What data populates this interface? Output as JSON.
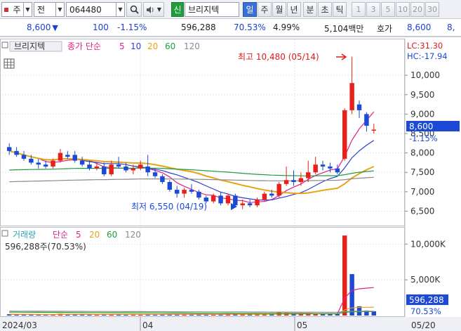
{
  "toolbar": {
    "market": "주",
    "jeon": "전",
    "code": "064480",
    "sin": "신",
    "name": "브리지텍",
    "periods": [
      "일",
      "주",
      "월",
      "년",
      "분",
      "초",
      "틱"
    ],
    "active_period": "일",
    "intervals": [
      "1",
      "3",
      "5",
      "10",
      "20",
      "30"
    ]
  },
  "quote": {
    "price": "8,600",
    "change": "100",
    "change_pct": "-1.15%",
    "volume": "596,288",
    "volume_ratio": "70.53%",
    "turnover": "4.99%",
    "amount": "5,104백만",
    "hoga_label": "호가",
    "hoga_price": "8,600",
    "trail": "8,"
  },
  "price_panel": {
    "legend_tab": "브리지텍",
    "ma_label": "종가 단순",
    "ma_periods": [
      "5",
      "10",
      "20",
      "60",
      "120"
    ],
    "ma_colors": [
      "#e0218a",
      "#2b3fd1",
      "#e8a317",
      "#1f9e3b",
      "#8a8a8a"
    ],
    "lc": "LC:31.30",
    "hc": "HC:-17.94",
    "current_price": "8,600",
    "current_pct": "-1.15%",
    "high_annotation": "최고 10,480 (05/14)",
    "low_annotation": "최저 6,550 (04/19)",
    "up_color": "#e8201a",
    "down_color": "#1c49d6"
  },
  "volume_panel": {
    "title": "거래량",
    "ma_label": "단순",
    "ma_periods": [
      "5",
      "20",
      "60",
      "120"
    ],
    "summary": "596,288주(70.53%)",
    "current_value": "596,288",
    "current_pct": "70.53%"
  },
  "x_axis": {
    "labels": [
      "2024/03",
      "04",
      "05"
    ],
    "right_label": "05/20"
  },
  "chart_data": {
    "type": "candlestick",
    "y_ticks": [
      10000,
      9500,
      9000,
      8500,
      8000,
      7500,
      7000,
      6500
    ],
    "ylim": [
      6200,
      10800
    ],
    "volume_ticks": [
      "10,000K",
      "5,000K"
    ],
    "volume_ylim": [
      0,
      12000
    ],
    "candles": [
      {
        "o": 8150,
        "h": 8250,
        "l": 7950,
        "c": 8050
      },
      {
        "o": 8050,
        "h": 8150,
        "l": 7900,
        "c": 7950
      },
      {
        "o": 7950,
        "h": 8050,
        "l": 7800,
        "c": 7850
      },
      {
        "o": 7850,
        "h": 7950,
        "l": 7700,
        "c": 7750
      },
      {
        "o": 7750,
        "h": 7850,
        "l": 7600,
        "c": 7700
      },
      {
        "o": 7700,
        "h": 7800,
        "l": 7600,
        "c": 7650
      },
      {
        "o": 7650,
        "h": 7850,
        "l": 7600,
        "c": 7800
      },
      {
        "o": 7800,
        "h": 8100,
        "l": 7750,
        "c": 8000
      },
      {
        "o": 7950,
        "h": 8050,
        "l": 7850,
        "c": 7900
      },
      {
        "o": 7950,
        "h": 8050,
        "l": 7750,
        "c": 7800
      },
      {
        "o": 7800,
        "h": 7900,
        "l": 7650,
        "c": 7700
      },
      {
        "o": 7700,
        "h": 7800,
        "l": 7550,
        "c": 7600
      },
      {
        "o": 7600,
        "h": 7750,
        "l": 7550,
        "c": 7650
      },
      {
        "o": 7650,
        "h": 7750,
        "l": 7400,
        "c": 7450
      },
      {
        "o": 7450,
        "h": 7800,
        "l": 7400,
        "c": 7700
      },
      {
        "o": 7700,
        "h": 7900,
        "l": 7600,
        "c": 7650
      },
      {
        "o": 7650,
        "h": 7750,
        "l": 7500,
        "c": 7550
      },
      {
        "o": 7550,
        "h": 7700,
        "l": 7450,
        "c": 7600
      },
      {
        "o": 7600,
        "h": 7800,
        "l": 7550,
        "c": 7700
      },
      {
        "o": 7650,
        "h": 7950,
        "l": 7400,
        "c": 7500
      },
      {
        "o": 7500,
        "h": 7600,
        "l": 7350,
        "c": 7400
      },
      {
        "o": 7400,
        "h": 7450,
        "l": 7200,
        "c": 7250
      },
      {
        "o": 7250,
        "h": 7300,
        "l": 7000,
        "c": 7050
      },
      {
        "o": 7050,
        "h": 7150,
        "l": 6850,
        "c": 6950
      },
      {
        "o": 6950,
        "h": 7100,
        "l": 6850,
        "c": 7050
      },
      {
        "o": 7050,
        "h": 7200,
        "l": 6950,
        "c": 7000
      },
      {
        "o": 7000,
        "h": 7050,
        "l": 6800,
        "c": 6850
      },
      {
        "o": 6850,
        "h": 6900,
        "l": 6700,
        "c": 6750
      },
      {
        "o": 6750,
        "h": 6950,
        "l": 6700,
        "c": 6900
      },
      {
        "o": 6900,
        "h": 7000,
        "l": 6650,
        "c": 6700
      },
      {
        "o": 6700,
        "h": 6950,
        "l": 6650,
        "c": 6900
      },
      {
        "o": 6900,
        "h": 6950,
        "l": 6600,
        "c": 6650
      },
      {
        "o": 6650,
        "h": 6800,
        "l": 6550,
        "c": 6700
      },
      {
        "o": 6700,
        "h": 6800,
        "l": 6600,
        "c": 6650
      },
      {
        "o": 6650,
        "h": 6850,
        "l": 6600,
        "c": 6800
      },
      {
        "o": 6800,
        "h": 7000,
        "l": 6750,
        "c": 6950
      },
      {
        "o": 6950,
        "h": 7050,
        "l": 6850,
        "c": 6900
      },
      {
        "o": 6900,
        "h": 7250,
        "l": 6850,
        "c": 7200
      },
      {
        "o": 7200,
        "h": 7650,
        "l": 7150,
        "c": 7300
      },
      {
        "o": 7300,
        "h": 7550,
        "l": 7150,
        "c": 7250
      },
      {
        "o": 7250,
        "h": 7500,
        "l": 7150,
        "c": 7350
      },
      {
        "o": 7350,
        "h": 7800,
        "l": 7250,
        "c": 7500
      },
      {
        "o": 7500,
        "h": 7900,
        "l": 7450,
        "c": 7700
      },
      {
        "o": 7700,
        "h": 7800,
        "l": 7550,
        "c": 7650
      },
      {
        "o": 7650,
        "h": 7750,
        "l": 7500,
        "c": 7600
      },
      {
        "o": 7600,
        "h": 7700,
        "l": 7450,
        "c": 7500
      },
      {
        "o": 7850,
        "h": 9150,
        "l": 7800,
        "c": 9100
      },
      {
        "o": 9100,
        "h": 10480,
        "l": 9000,
        "c": 9800
      },
      {
        "o": 9250,
        "h": 9350,
        "l": 8900,
        "c": 9100
      },
      {
        "o": 9000,
        "h": 9050,
        "l": 8550,
        "c": 8700
      },
      {
        "o": 8600,
        "h": 8750,
        "l": 8500,
        "c": 8600
      }
    ],
    "volumes": [
      180,
      160,
      150,
      140,
      120,
      130,
      170,
      260,
      150,
      180,
      150,
      140,
      130,
      200,
      180,
      160,
      150,
      140,
      170,
      190,
      170,
      190,
      210,
      180,
      160,
      150,
      170,
      180,
      190,
      200,
      240,
      260,
      230,
      180,
      200,
      220,
      240,
      420,
      380,
      250,
      230,
      280,
      300,
      240,
      210,
      200,
      11200,
      5800,
      1300,
      700,
      596
    ],
    "volume_direction": [
      0,
      0,
      0,
      0,
      0,
      0,
      1,
      1,
      0,
      0,
      0,
      0,
      1,
      0,
      1,
      0,
      0,
      1,
      1,
      0,
      0,
      0,
      0,
      0,
      1,
      0,
      0,
      0,
      1,
      0,
      1,
      0,
      1,
      0,
      1,
      1,
      0,
      1,
      1,
      0,
      1,
      1,
      1,
      0,
      0,
      0,
      1,
      0,
      0,
      0,
      0
    ]
  }
}
